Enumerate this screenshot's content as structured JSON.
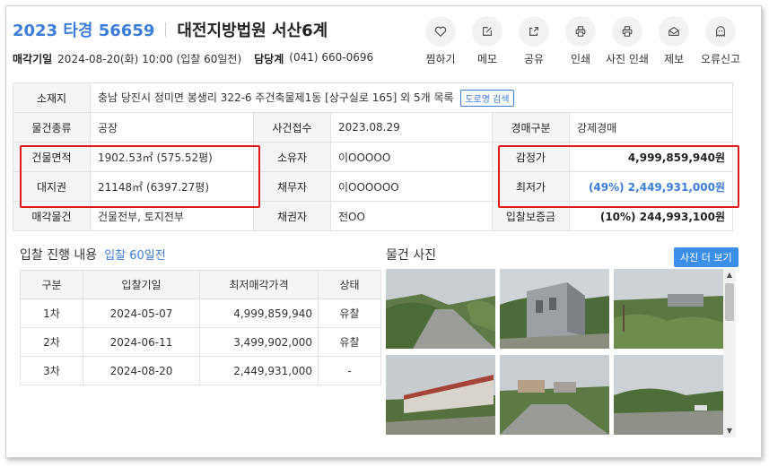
{
  "header": {
    "case_no": "2023 타경 56659",
    "court": "대전지방법원 서산6계",
    "sale_date_label": "매각기일",
    "sale_date_value": "2024-08-20(화) 10:00 (입찰 60일전)",
    "contact_label": "담당계",
    "contact_value": "(041) 660-0696"
  },
  "actions": [
    {
      "label": "찜하기",
      "icon": "heart-icon"
    },
    {
      "label": "메모",
      "icon": "memo-icon"
    },
    {
      "label": "공유",
      "icon": "share-icon"
    },
    {
      "label": "인쇄",
      "icon": "print-icon"
    },
    {
      "label": "사진 인쇄",
      "icon": "photo-print-icon"
    },
    {
      "label": "제보",
      "icon": "mail-icon"
    },
    {
      "label": "오류신고",
      "icon": "ghost-icon"
    }
  ],
  "info": {
    "location_label": "소재지",
    "location_value": "충남 당진시 정미면 봉생리 322-6 주건축물제1동 [상구실로 165] 외 5개 목록",
    "road_btn": "도로명 검색",
    "type_label": "물건종류",
    "type_value": "공장",
    "filed_label": "사건접수",
    "filed_value": "2023.08.29",
    "auction_type_label": "경매구분",
    "auction_type_value": "강제경매",
    "building_area_label": "건물면적",
    "building_area_value": "1902.53㎡ (575.52평)",
    "owner_label": "소유자",
    "owner_value": "이OOOOO",
    "appraisal_label": "감정가",
    "appraisal_value": "4,999,859,940원",
    "land_label": "대지권",
    "land_value": "21148㎡ (6397.27평)",
    "debtor_label": "채무자",
    "debtor_value": "이OOOOOO",
    "min_price_label": "최저가",
    "min_price_value": "(49%) 2,449,931,000원",
    "sale_items_label": "매각물건",
    "sale_items_value": "건물전부, 토지전부",
    "creditor_label": "채권자",
    "creditor_value": "전OO",
    "deposit_label": "입찰보증금",
    "deposit_value": "(10%) 244,993,100원"
  },
  "bids": {
    "title": "입찰 진행 내용",
    "subtitle": "입찰 60일전",
    "headers": [
      "구분",
      "입찰기일",
      "최저매각가격",
      "상태"
    ],
    "rows": [
      [
        "1차",
        "2024-05-07",
        "4,999,859,940",
        "유찰"
      ],
      [
        "2차",
        "2024-06-11",
        "3,499,902,000",
        "유찰"
      ],
      [
        "3차",
        "2024-08-20",
        "2,449,931,000",
        "-"
      ]
    ]
  },
  "photos": {
    "title": "물건 사진",
    "more_label": "사진 더 보기"
  },
  "colors": {
    "accent": "#3b7dd8",
    "highlight": "#e0191b",
    "header_bg": "#f4f5f7"
  }
}
